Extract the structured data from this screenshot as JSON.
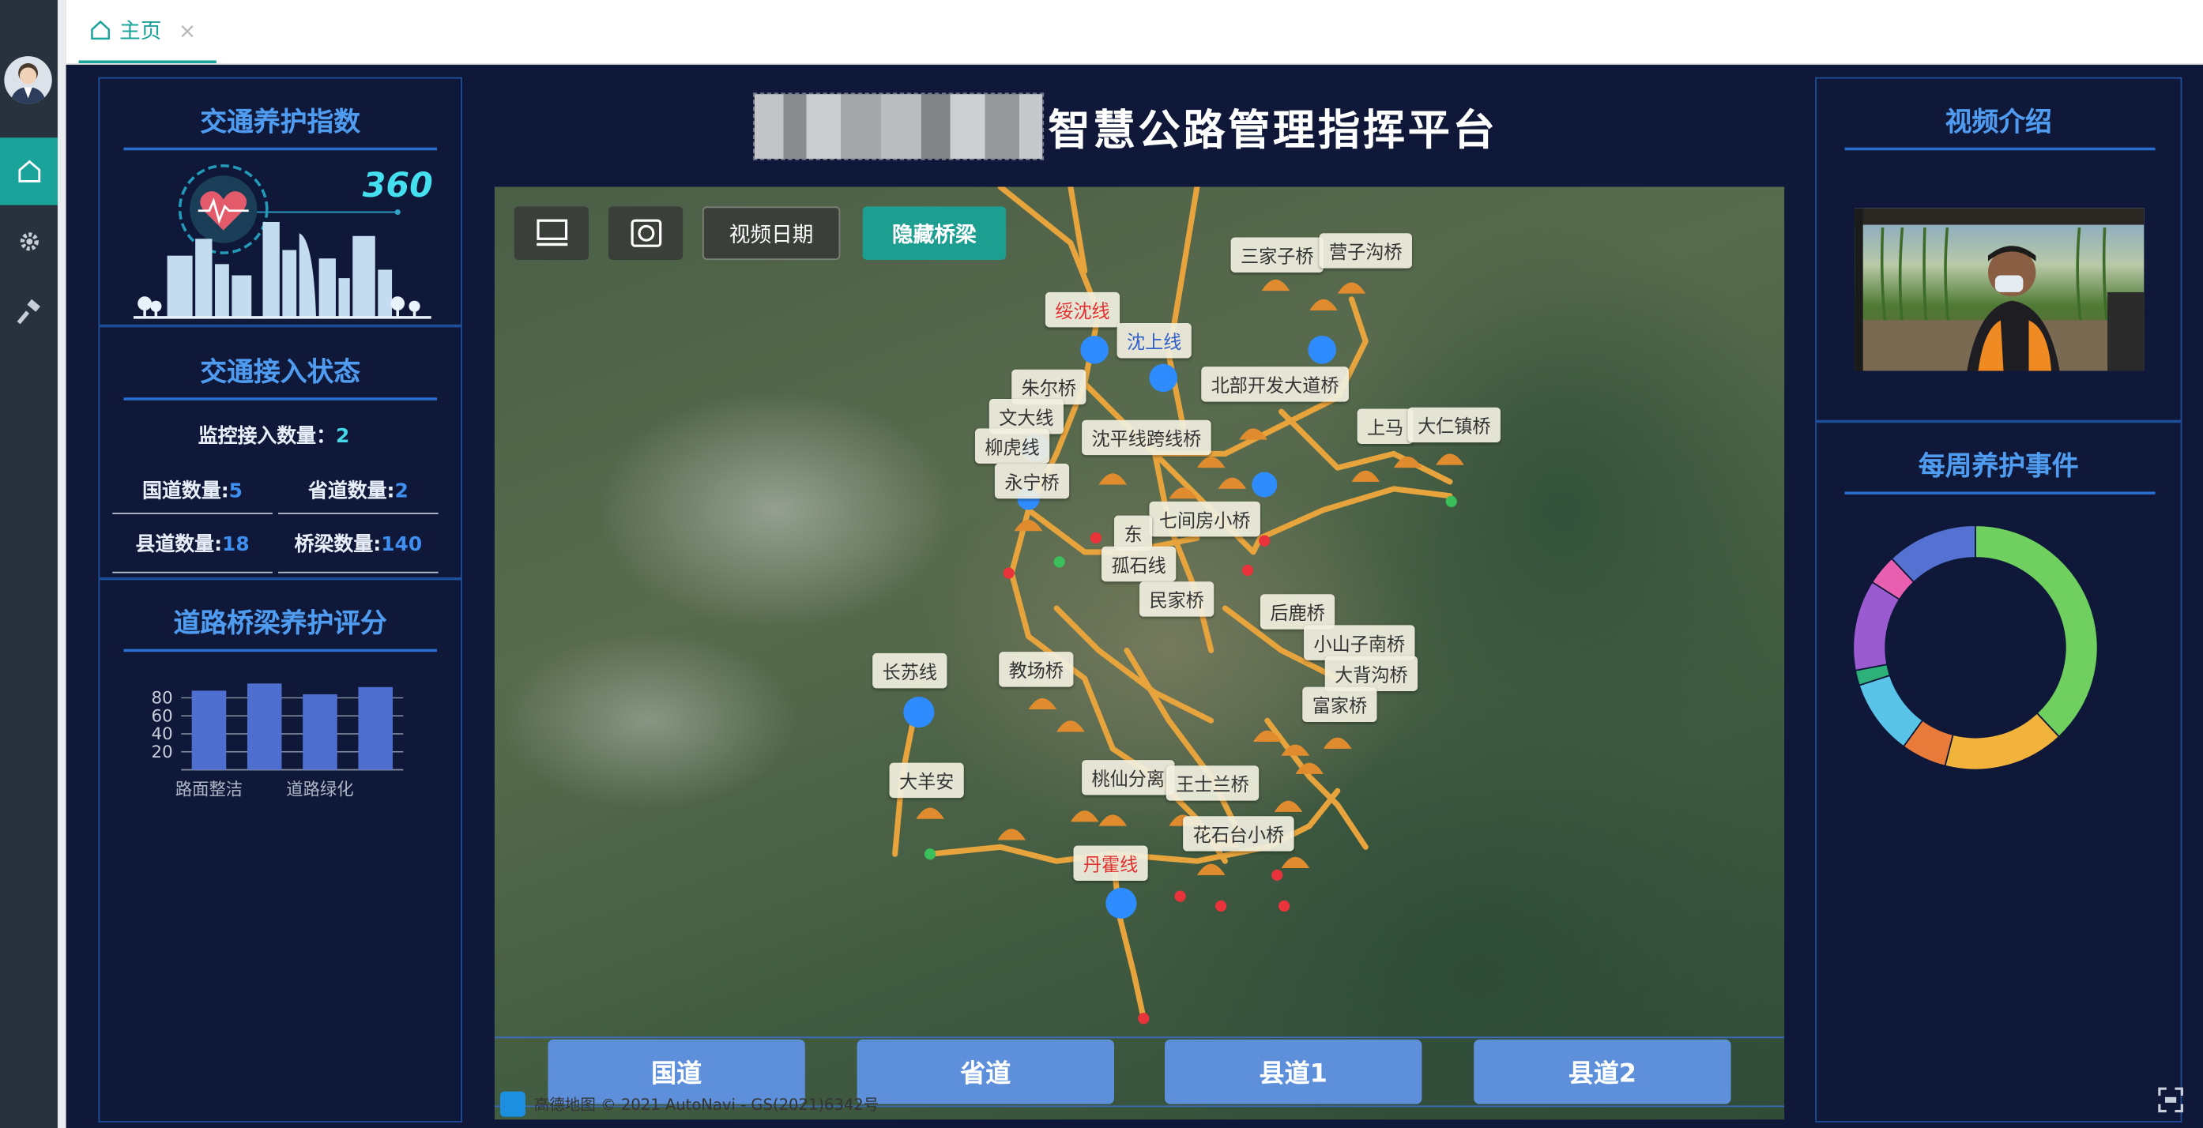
{
  "tabbar": {
    "tab_label": "主页",
    "tab_icon": "home-icon",
    "close": "×"
  },
  "sidebar": {
    "icons": [
      "home-icon",
      "gear-icon",
      "hammer-icon"
    ]
  },
  "header": {
    "title": "智慧公路管理指挥平台"
  },
  "index_panel": {
    "title": "交通养护指数",
    "value": "360"
  },
  "access_panel": {
    "title": "交通接入状态",
    "monitor_label": "监控接入数量：",
    "monitor_value": "2",
    "stats": [
      {
        "label": "国道数量:",
        "value": "5"
      },
      {
        "label": "省道数量:",
        "value": "2"
      },
      {
        "label": "县道数量:",
        "value": "18"
      },
      {
        "label": "桥梁数量:",
        "value": "140"
      }
    ]
  },
  "score_panel": {
    "title": "道路桥梁养护评分",
    "chart_data": {
      "type": "bar",
      "categories": [
        "路面整洁",
        "",
        "道路绿化",
        ""
      ],
      "values": [
        88,
        96,
        84,
        92
      ],
      "yticks": [
        "80",
        "60",
        "40",
        "20"
      ],
      "ylim": [
        0,
        100
      ],
      "color": "#4f6fd0"
    }
  },
  "video_panel": {
    "title": "视频介绍"
  },
  "events_panel": {
    "title": "每周养护事件",
    "chart_data": {
      "type": "pie",
      "values": [
        38,
        16,
        6,
        10,
        2,
        12,
        4,
        12
      ],
      "colors": [
        "#6fcf5f",
        "#f2b33d",
        "#e87a3a",
        "#5ac4e8",
        "#2db07a",
        "#9b5bd0",
        "#e95fb0",
        "#5572d3"
      ]
    }
  },
  "map": {
    "controls": {
      "date_label": "视频日期",
      "hide_label": "隐藏桥梁"
    },
    "road_buttons": [
      "国道",
      "省道",
      "县道1",
      "县道2"
    ],
    "copyright": "高德地图 © 2021 AutoNavi - GS(2021)6342号",
    "labels": [
      {
        "text": "绥沈线",
        "color": "red"
      },
      {
        "text": "沈上线",
        "color": "blue"
      },
      {
        "text": "三家子桥",
        "color": "dark"
      },
      {
        "text": "营子沟桥",
        "color": "dark"
      },
      {
        "text": "朱尔桥",
        "color": "dark"
      },
      {
        "text": "北部开发大道桥",
        "color": "dark"
      },
      {
        "text": "文大线",
        "color": "dark"
      },
      {
        "text": "沈平线跨线桥",
        "color": "dark"
      },
      {
        "text": "上马",
        "color": "dark"
      },
      {
        "text": "大仁镇桥",
        "color": "dark"
      },
      {
        "text": "柳虎线",
        "color": "dark"
      },
      {
        "text": "永宁桥",
        "color": "dark"
      },
      {
        "text": "七间房小桥",
        "color": "dark"
      },
      {
        "text": "东",
        "color": "dark"
      },
      {
        "text": "孤石线",
        "color": "dark"
      },
      {
        "text": "民家桥",
        "color": "dark"
      },
      {
        "text": "后鹿桥",
        "color": "dark"
      },
      {
        "text": "小山子南桥",
        "color": "dark"
      },
      {
        "text": "长苏线",
        "color": "dark"
      },
      {
        "text": "教场桥",
        "color": "dark"
      },
      {
        "text": "大背沟桥",
        "color": "dark"
      },
      {
        "text": "富家桥",
        "color": "dark"
      },
      {
        "text": "大羊安",
        "color": "dark"
      },
      {
        "text": "桃仙分离",
        "color": "dark"
      },
      {
        "text": "王士兰桥",
        "color": "dark"
      },
      {
        "text": "花石台小桥",
        "color": "dark"
      },
      {
        "text": "丹霍线",
        "color": "red"
      }
    ]
  }
}
